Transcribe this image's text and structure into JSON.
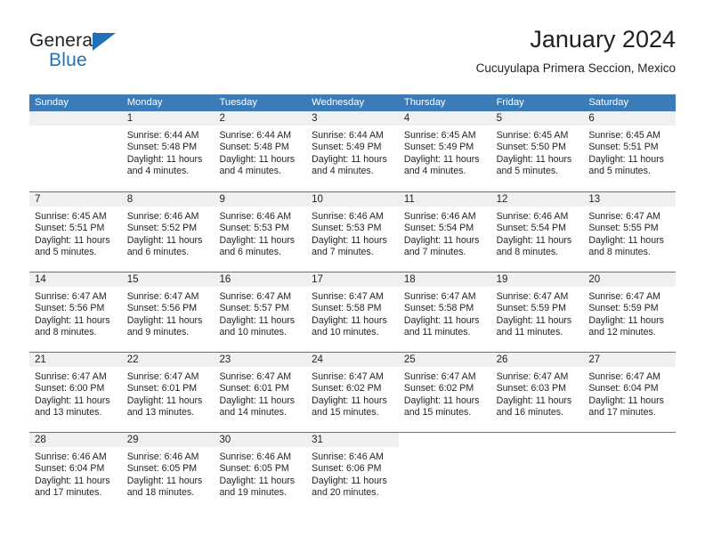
{
  "brand": {
    "name_top": "General",
    "name_bottom": "Blue",
    "accent_color": "#1f72b8"
  },
  "header": {
    "title": "January 2024",
    "subtitle": "Cucuyulapa Primera Seccion, Mexico"
  },
  "theme": {
    "header_bar_color": "#3b7cb8",
    "daynum_band_color": "#f0f0f0",
    "text_color": "#231f20"
  },
  "weekday_headers": [
    "Sunday",
    "Monday",
    "Tuesday",
    "Wednesday",
    "Thursday",
    "Friday",
    "Saturday"
  ],
  "weeks": [
    [
      {
        "day": "",
        "lines": [
          "",
          "",
          "",
          ""
        ],
        "state": "empty"
      },
      {
        "day": "1",
        "lines": [
          "Sunrise: 6:44 AM",
          "Sunset: 5:48 PM",
          "Daylight: 11 hours",
          "and 4 minutes."
        ],
        "state": "filled"
      },
      {
        "day": "2",
        "lines": [
          "Sunrise: 6:44 AM",
          "Sunset: 5:48 PM",
          "Daylight: 11 hours",
          "and 4 minutes."
        ],
        "state": "filled"
      },
      {
        "day": "3",
        "lines": [
          "Sunrise: 6:44 AM",
          "Sunset: 5:49 PM",
          "Daylight: 11 hours",
          "and 4 minutes."
        ],
        "state": "filled"
      },
      {
        "day": "4",
        "lines": [
          "Sunrise: 6:45 AM",
          "Sunset: 5:49 PM",
          "Daylight: 11 hours",
          "and 4 minutes."
        ],
        "state": "filled"
      },
      {
        "day": "5",
        "lines": [
          "Sunrise: 6:45 AM",
          "Sunset: 5:50 PM",
          "Daylight: 11 hours",
          "and 5 minutes."
        ],
        "state": "filled"
      },
      {
        "day": "6",
        "lines": [
          "Sunrise: 6:45 AM",
          "Sunset: 5:51 PM",
          "Daylight: 11 hours",
          "and 5 minutes."
        ],
        "state": "filled"
      }
    ],
    [
      {
        "day": "7",
        "lines": [
          "Sunrise: 6:45 AM",
          "Sunset: 5:51 PM",
          "Daylight: 11 hours",
          "and 5 minutes."
        ],
        "state": "filled"
      },
      {
        "day": "8",
        "lines": [
          "Sunrise: 6:46 AM",
          "Sunset: 5:52 PM",
          "Daylight: 11 hours",
          "and 6 minutes."
        ],
        "state": "filled"
      },
      {
        "day": "9",
        "lines": [
          "Sunrise: 6:46 AM",
          "Sunset: 5:53 PM",
          "Daylight: 11 hours",
          "and 6 minutes."
        ],
        "state": "filled"
      },
      {
        "day": "10",
        "lines": [
          "Sunrise: 6:46 AM",
          "Sunset: 5:53 PM",
          "Daylight: 11 hours",
          "and 7 minutes."
        ],
        "state": "filled"
      },
      {
        "day": "11",
        "lines": [
          "Sunrise: 6:46 AM",
          "Sunset: 5:54 PM",
          "Daylight: 11 hours",
          "and 7 minutes."
        ],
        "state": "filled"
      },
      {
        "day": "12",
        "lines": [
          "Sunrise: 6:46 AM",
          "Sunset: 5:54 PM",
          "Daylight: 11 hours",
          "and 8 minutes."
        ],
        "state": "filled"
      },
      {
        "day": "13",
        "lines": [
          "Sunrise: 6:47 AM",
          "Sunset: 5:55 PM",
          "Daylight: 11 hours",
          "and 8 minutes."
        ],
        "state": "filled"
      }
    ],
    [
      {
        "day": "14",
        "lines": [
          "Sunrise: 6:47 AM",
          "Sunset: 5:56 PM",
          "Daylight: 11 hours",
          "and 8 minutes."
        ],
        "state": "filled"
      },
      {
        "day": "15",
        "lines": [
          "Sunrise: 6:47 AM",
          "Sunset: 5:56 PM",
          "Daylight: 11 hours",
          "and 9 minutes."
        ],
        "state": "filled"
      },
      {
        "day": "16",
        "lines": [
          "Sunrise: 6:47 AM",
          "Sunset: 5:57 PM",
          "Daylight: 11 hours",
          "and 10 minutes."
        ],
        "state": "filled"
      },
      {
        "day": "17",
        "lines": [
          "Sunrise: 6:47 AM",
          "Sunset: 5:58 PM",
          "Daylight: 11 hours",
          "and 10 minutes."
        ],
        "state": "filled"
      },
      {
        "day": "18",
        "lines": [
          "Sunrise: 6:47 AM",
          "Sunset: 5:58 PM",
          "Daylight: 11 hours",
          "and 11 minutes."
        ],
        "state": "filled"
      },
      {
        "day": "19",
        "lines": [
          "Sunrise: 6:47 AM",
          "Sunset: 5:59 PM",
          "Daylight: 11 hours",
          "and 11 minutes."
        ],
        "state": "filled"
      },
      {
        "day": "20",
        "lines": [
          "Sunrise: 6:47 AM",
          "Sunset: 5:59 PM",
          "Daylight: 11 hours",
          "and 12 minutes."
        ],
        "state": "filled"
      }
    ],
    [
      {
        "day": "21",
        "lines": [
          "Sunrise: 6:47 AM",
          "Sunset: 6:00 PM",
          "Daylight: 11 hours",
          "and 13 minutes."
        ],
        "state": "filled"
      },
      {
        "day": "22",
        "lines": [
          "Sunrise: 6:47 AM",
          "Sunset: 6:01 PM",
          "Daylight: 11 hours",
          "and 13 minutes."
        ],
        "state": "filled"
      },
      {
        "day": "23",
        "lines": [
          "Sunrise: 6:47 AM",
          "Sunset: 6:01 PM",
          "Daylight: 11 hours",
          "and 14 minutes."
        ],
        "state": "filled"
      },
      {
        "day": "24",
        "lines": [
          "Sunrise: 6:47 AM",
          "Sunset: 6:02 PM",
          "Daylight: 11 hours",
          "and 15 minutes."
        ],
        "state": "filled"
      },
      {
        "day": "25",
        "lines": [
          "Sunrise: 6:47 AM",
          "Sunset: 6:02 PM",
          "Daylight: 11 hours",
          "and 15 minutes."
        ],
        "state": "filled"
      },
      {
        "day": "26",
        "lines": [
          "Sunrise: 6:47 AM",
          "Sunset: 6:03 PM",
          "Daylight: 11 hours",
          "and 16 minutes."
        ],
        "state": "filled"
      },
      {
        "day": "27",
        "lines": [
          "Sunrise: 6:47 AM",
          "Sunset: 6:04 PM",
          "Daylight: 11 hours",
          "and 17 minutes."
        ],
        "state": "filled"
      }
    ],
    [
      {
        "day": "28",
        "lines": [
          "Sunrise: 6:46 AM",
          "Sunset: 6:04 PM",
          "Daylight: 11 hours",
          "and 17 minutes."
        ],
        "state": "filled"
      },
      {
        "day": "29",
        "lines": [
          "Sunrise: 6:46 AM",
          "Sunset: 6:05 PM",
          "Daylight: 11 hours",
          "and 18 minutes."
        ],
        "state": "filled"
      },
      {
        "day": "30",
        "lines": [
          "Sunrise: 6:46 AM",
          "Sunset: 6:05 PM",
          "Daylight: 11 hours",
          "and 19 minutes."
        ],
        "state": "filled"
      },
      {
        "day": "31",
        "lines": [
          "Sunrise: 6:46 AM",
          "Sunset: 6:06 PM",
          "Daylight: 11 hours",
          "and 20 minutes."
        ],
        "state": "filled"
      },
      {
        "day": "",
        "lines": [
          "",
          "",
          "",
          ""
        ],
        "state": "blank"
      },
      {
        "day": "",
        "lines": [
          "",
          "",
          "",
          ""
        ],
        "state": "blank"
      },
      {
        "day": "",
        "lines": [
          "",
          "",
          "",
          ""
        ],
        "state": "blank"
      }
    ]
  ]
}
